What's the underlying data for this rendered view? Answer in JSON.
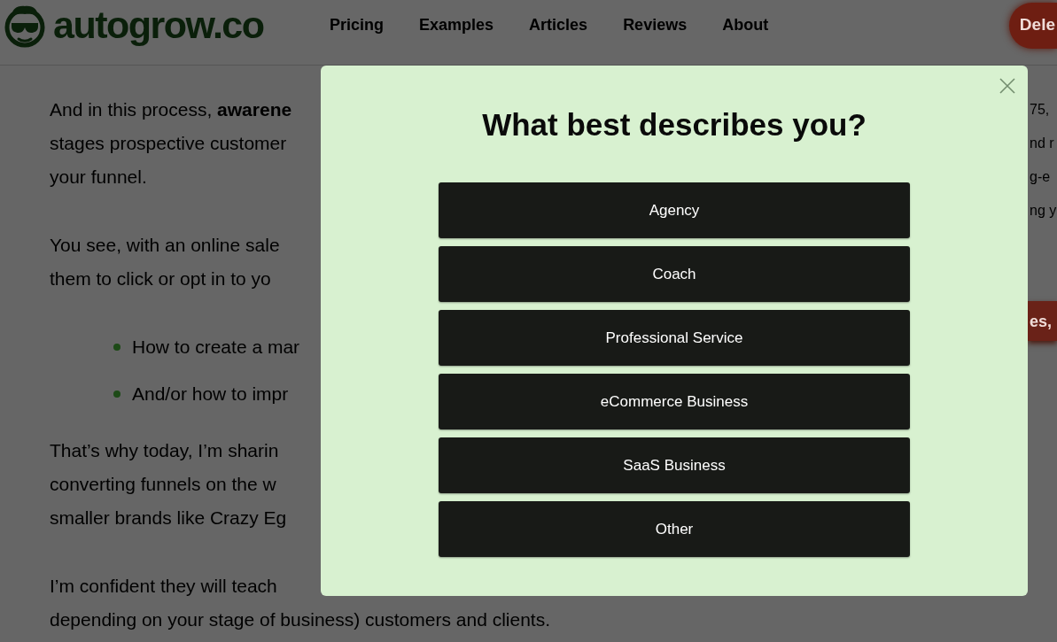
{
  "header": {
    "logo_text": "autogrow.co",
    "nav": [
      "Pricing",
      "Examples",
      "Articles",
      "Reviews",
      "About"
    ],
    "cta_button": "Dele"
  },
  "article": {
    "blocks": [
      {
        "kind": "paragraph",
        "lines": [
          "And in this process, **awarene**",
          "stages prospective customer",
          "your funnel."
        ]
      },
      {
        "kind": "paragraph",
        "lines": [
          "You see, with an online sale",
          "them to click or opt in to yo"
        ]
      },
      {
        "kind": "bullets",
        "items": [
          "How to create a mar",
          "And/or how to impr"
        ]
      },
      {
        "kind": "paragraph",
        "lines": [
          "That’s why today, I’m sharin",
          "converting funnels on the w",
          "smaller brands like Crazy Eg"
        ]
      },
      {
        "kind": "paragraph",
        "lines": [
          "I’m confident they will teach",
          "depending on your stage of business) customers and clients."
        ]
      }
    ]
  },
  "sidebar": {
    "lines": [
      "75,",
      "nd r",
      "g-e",
      "ng y"
    ],
    "banner": "es,"
  },
  "modal": {
    "title": "What best describes you?",
    "options": [
      "Agency",
      "Coach",
      "Professional Service",
      "eCommerce Business",
      "SaaS Business",
      "Other"
    ]
  }
}
